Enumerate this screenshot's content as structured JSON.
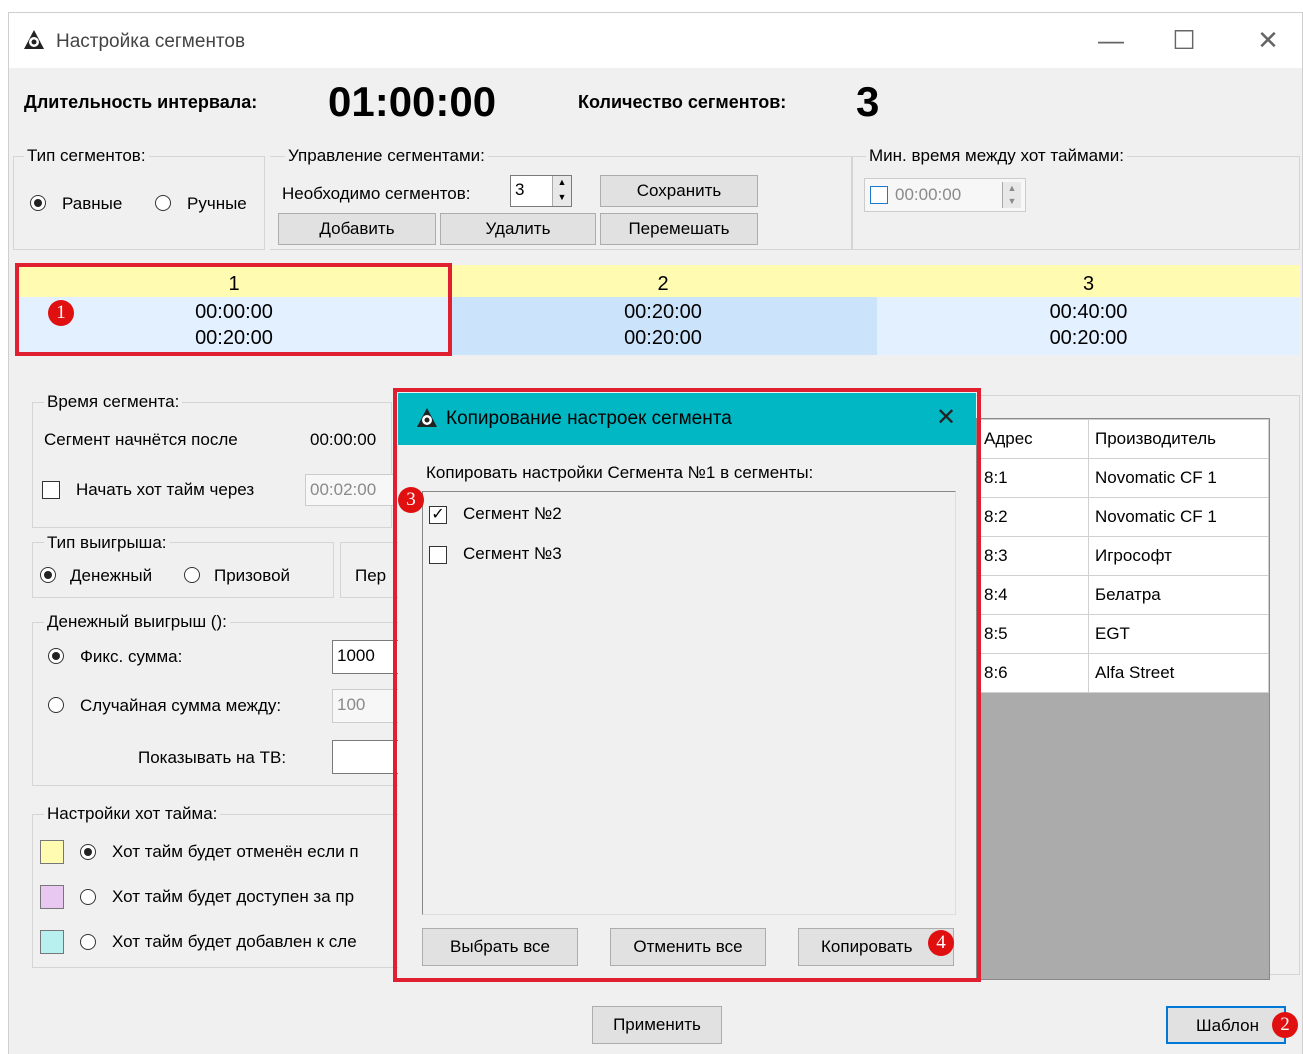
{
  "window": {
    "title": "Настройка сегментов"
  },
  "header": {
    "duration_label": "Длительность интервала:",
    "duration_value": "01:00:00",
    "count_label": "Количество сегментов:",
    "count_value": "3"
  },
  "segment_type": {
    "group_label": "Тип сегментов:",
    "equal": "Равные",
    "manual": "Ручные"
  },
  "segment_mgmt": {
    "group_label": "Управление сегментами:",
    "needed_label": "Необходимо сегментов:",
    "needed_value": "3",
    "save": "Сохранить",
    "add": "Добавить",
    "delete": "Удалить",
    "shuffle": "Перемешать"
  },
  "min_time": {
    "group_label": "Мин. время между хот таймами:",
    "value": "00:00:00"
  },
  "segments": [
    {
      "num": "1",
      "start": "00:00:00",
      "dur": "00:20:00"
    },
    {
      "num": "2",
      "start": "00:20:00",
      "dur": "00:20:00"
    },
    {
      "num": "3",
      "start": "00:40:00",
      "dur": "00:20:00"
    }
  ],
  "markers": {
    "m1": "1",
    "m2": "2",
    "m3": "3",
    "m4": "4"
  },
  "seg_time": {
    "group_label": "Время сегмента:",
    "starts_after_label": "Сегмент начнётся после",
    "starts_after_value": "00:00:00",
    "hot_start_label": "Начать хот тайм через",
    "hot_start_value": "00:02:00"
  },
  "win_type": {
    "group_label": "Тип выигрыша:",
    "money": "Денежный",
    "prize": "Призовой",
    "partial": "Пер"
  },
  "money_win": {
    "group_label": "Денежный выигрыш ():",
    "fixed_label": "Фикс. сумма:",
    "fixed_value": "1000",
    "random_label": "Случайная сумма между:",
    "random_value": "100",
    "tv_label": "Показывать на ТВ:"
  },
  "hot_settings": {
    "group_label": "Настройки хот тайма:",
    "opt1": "Хот тайм будет отменён если п",
    "opt2": "Хот тайм будет доступен за пр",
    "opt3": "Хот тайм будет добавлен к сле",
    "colors": [
      "#fffbb0",
      "#e8c8f0",
      "#b8f0f0"
    ]
  },
  "devices": {
    "headers": {
      "address": "Адрес",
      "maker": "Производитель"
    },
    "rows": [
      {
        "address": "8:1",
        "maker": "Novomatic CF 1"
      },
      {
        "address": "8:2",
        "maker": "Novomatic CF 1"
      },
      {
        "address": "8:3",
        "maker": "Игрософт"
      },
      {
        "address": "8:4",
        "maker": "Белатра"
      },
      {
        "address": "8:5",
        "maker": "EGT"
      },
      {
        "address": "8:6",
        "maker": "Alfa Street"
      }
    ]
  },
  "dialog": {
    "title": "Копирование настроек сегмента",
    "prompt": "Копировать настройки Сегмента №1 в сегменты:",
    "items": [
      {
        "label": "Сегмент №2",
        "checked": true
      },
      {
        "label": "Сегмент №3",
        "checked": false
      }
    ],
    "select_all": "Выбрать все",
    "deselect_all": "Отменить все",
    "copy": "Копировать",
    "accent": "#00b7c3"
  },
  "footer": {
    "apply": "Применить",
    "template": "Шаблон"
  }
}
